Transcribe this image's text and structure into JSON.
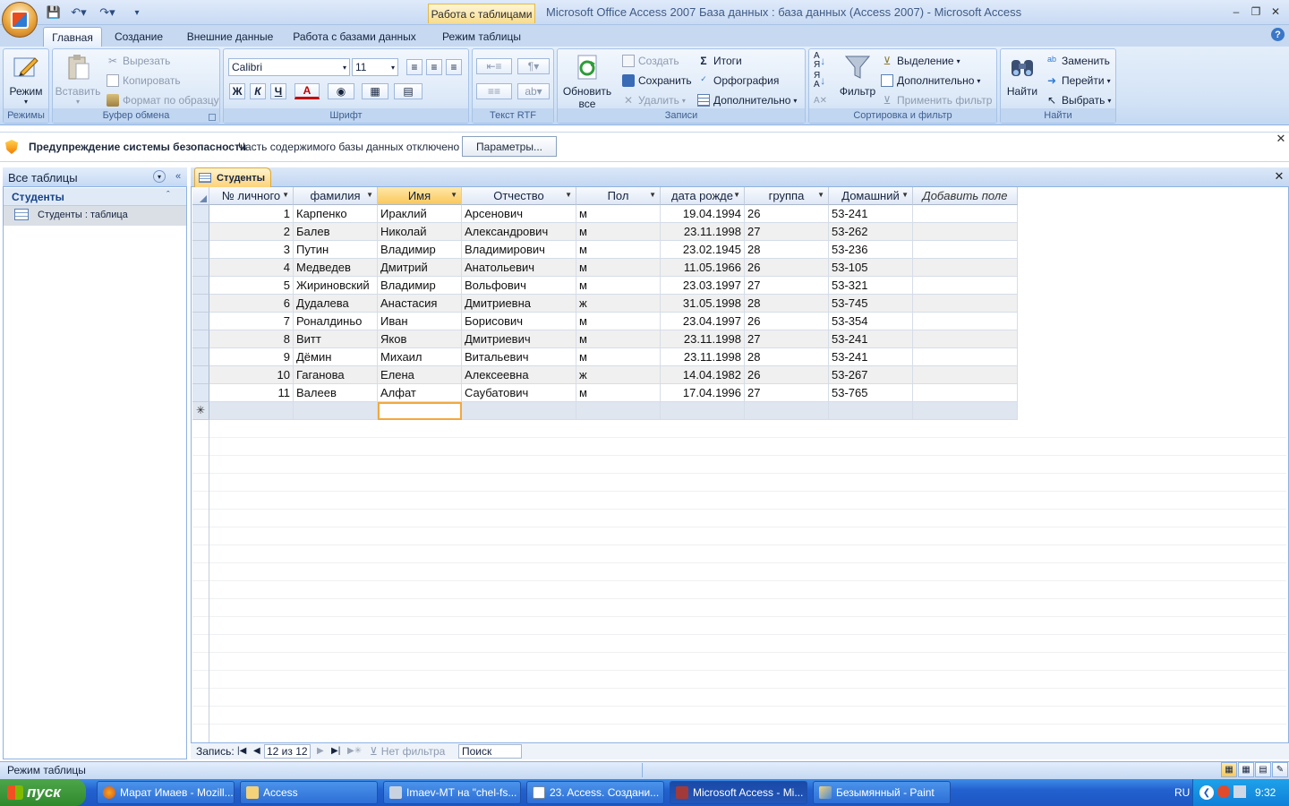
{
  "window": {
    "context_tab": "Работа с таблицами",
    "title": "Microsoft Office Access 2007 База данных : база данных (Access 2007) - Microsoft Access"
  },
  "ribbon_tabs": [
    "Главная",
    "Создание",
    "Внешние данные",
    "Работа с базами данных",
    "Режим таблицы"
  ],
  "ribbon": {
    "modes": {
      "label": "Режим",
      "group": "Режимы"
    },
    "clipboard": {
      "paste": "Вставить",
      "cut": "Вырезать",
      "copy": "Копировать",
      "format_painter": "Формат по образцу",
      "group": "Буфер обмена"
    },
    "font": {
      "name": "Calibri",
      "size": "11",
      "bold": "Ж",
      "italic": "К",
      "underline": "Ч",
      "color_letter": "А",
      "group": "Шрифт"
    },
    "rtf": {
      "group": "Текст RTF"
    },
    "records": {
      "refresh": "Обновить",
      "refresh2": "все",
      "new": "Создать",
      "save": "Сохранить",
      "delete": "Удалить",
      "totals": "Итоги",
      "spelling": "Орфография",
      "more": "Дополнительно",
      "group": "Записи"
    },
    "sort": {
      "filter": "Фильтр",
      "selection": "Выделение",
      "advanced": "Дополнительно",
      "toggle": "Применить фильтр",
      "group": "Сортировка и фильтр"
    },
    "find": {
      "find": "Найти",
      "replace": "Заменить",
      "goto": "Перейти",
      "select": "Выбрать",
      "group": "Найти"
    }
  },
  "security_bar": {
    "title": "Предупреждение системы безопасности",
    "message": "Часть содержимого базы данных отключено",
    "button": "Параметры..."
  },
  "nav_pane": {
    "title": "Все таблицы",
    "group": "Студенты",
    "item": "Студенты : таблица"
  },
  "document_tab": "Студенты",
  "table": {
    "columns": [
      "№ личного",
      "фамилия",
      "Имя",
      "Отчество",
      "Пол",
      "дата рожде",
      "группа",
      "Домашний",
      "Добавить поле"
    ],
    "rows": [
      [
        "1",
        "Карпенко",
        "Ираклий",
        "Арсенович",
        "м",
        "19.04.1994",
        "26",
        "53-241"
      ],
      [
        "2",
        "Балев",
        "Николай",
        "Александрович",
        "м",
        "23.11.1998",
        "27",
        "53-262"
      ],
      [
        "3",
        "Путин",
        "Владимир",
        "Владимирович",
        "м",
        "23.02.1945",
        "28",
        "53-236"
      ],
      [
        "4",
        "Медведев",
        "Дмитрий",
        "Анатольевич",
        "м",
        "11.05.1966",
        "26",
        "53-105"
      ],
      [
        "5",
        "Жириновский",
        "Владимир",
        "Вольфович",
        "м",
        "23.03.1997",
        "27",
        "53-321"
      ],
      [
        "6",
        "Дудалева",
        "Анастасия",
        "Дмитриевна",
        "ж",
        "31.05.1998",
        "28",
        "53-745"
      ],
      [
        "7",
        "Роналдиньо",
        "Иван",
        "Борисович",
        "м",
        "23.04.1997",
        "26",
        "53-354"
      ],
      [
        "8",
        "Витт",
        "Яков",
        "Дмитриевич",
        "м",
        "23.11.1998",
        "27",
        "53-241"
      ],
      [
        "9",
        "Дёмин",
        "Михаил",
        "Витальевич",
        "м",
        "23.11.1998",
        "28",
        "53-241"
      ],
      [
        "10",
        "Гаганова",
        "Елена",
        "Алексеевна",
        "ж",
        "14.04.1982",
        "26",
        "53-267"
      ],
      [
        "11",
        "Валеев",
        "Алфат",
        "Саубатович",
        "м",
        "17.04.1996",
        "27",
        "53-765"
      ]
    ],
    "new_row_marker": "✳"
  },
  "record_nav": {
    "label": "Запись:",
    "current": "12 из 12",
    "filter": "Нет фильтра",
    "search": "Поиск"
  },
  "status": {
    "text": "Режим таблицы"
  },
  "taskbar": {
    "start": "пуск",
    "tasks": [
      "Марат Имаев - Mozill...",
      "Access",
      "Imaev-MT на \"chel-fs...",
      "23. Access. Создани...",
      "Microsoft Access - Mi...",
      "Безымянный - Paint"
    ],
    "lang": "RU",
    "time": "9:32"
  }
}
